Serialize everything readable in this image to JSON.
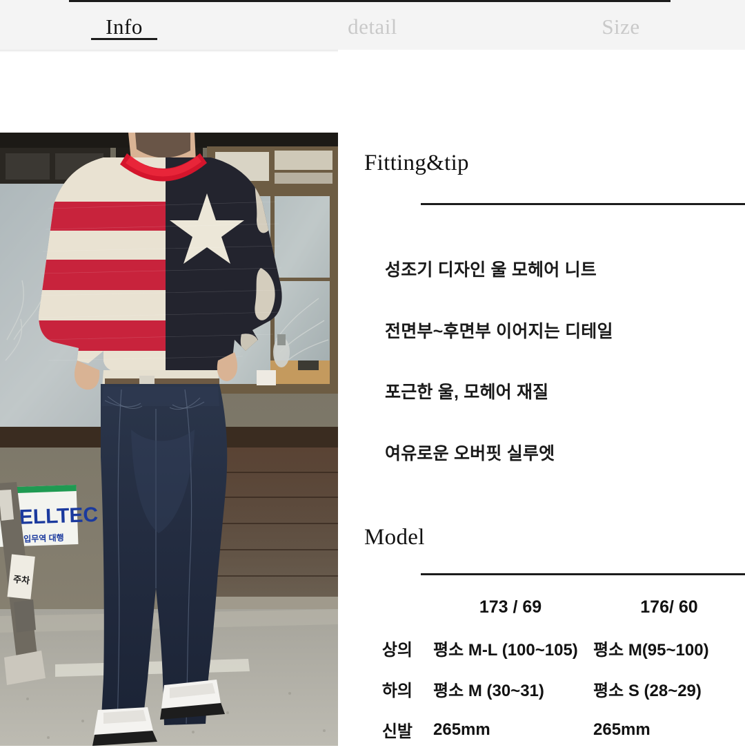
{
  "tabs": [
    {
      "label": "Info",
      "state": "active"
    },
    {
      "label": "detail",
      "state": "inactive"
    },
    {
      "label": "Size",
      "state": "inactive"
    }
  ],
  "photo": {
    "alt": "model-wearing-american-flag-mohair-knit-sweater-and-wide-denim-jeans",
    "signboard_text": "CELLTEC",
    "signboard_sub": "수입무역 대행",
    "aframe_sign_text": "주차금지"
  },
  "fitting": {
    "title": "Fitting&tip",
    "bullets": [
      "성조기 디자인 울 모헤어 니트",
      "전면부~후면부 이어지는 디테일",
      "포근한 울, 모헤어 재질",
      "여유로운 오버핏 실루엣"
    ]
  },
  "model": {
    "title": "Model",
    "columns": [
      "",
      "173 / 69",
      "176/ 60"
    ],
    "rows": [
      {
        "label": "상의",
        "a": "평소 M-L (100~105)",
        "b": "평소 M(95~100)"
      },
      {
        "label": "하의",
        "a": "평소 M (30~31)",
        "b": "평소 S (28~29)"
      },
      {
        "label": "신발",
        "a": "265mm",
        "b": "265mm"
      }
    ]
  },
  "colors": {
    "tabbar_bg": "#f4f4f4",
    "active_tab": "#111111",
    "inactive_tab": "#c9c9c9",
    "rule": "#1c1c1c",
    "text": "#1a1a1a",
    "sweater_red": "#c8233c",
    "sweater_cream": "#e9e2d2",
    "sweater_navy": "#23242e",
    "denim": "#222b3d",
    "shoe_white": "#f2f2f0"
  }
}
